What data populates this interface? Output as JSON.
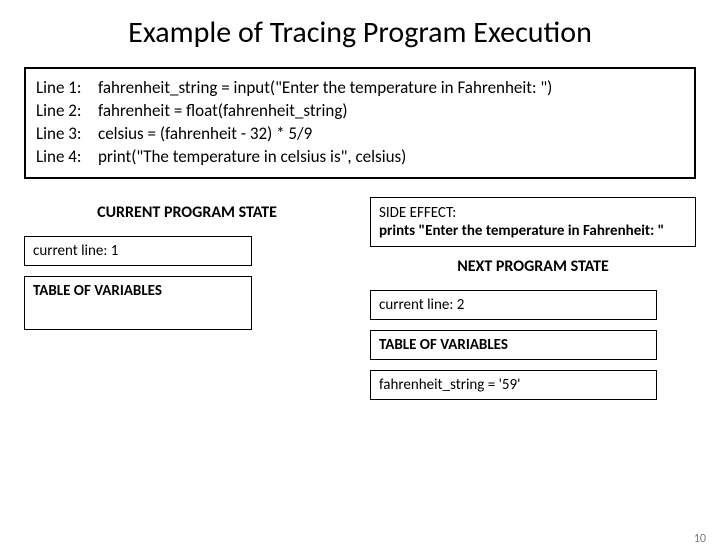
{
  "title": "Example of Tracing Program Execution",
  "code": {
    "lines": [
      {
        "label": "Line 1:",
        "text": "fahrenheit_string = input(\"Enter the temperature in Fahrenheit: \")"
      },
      {
        "label": "Line 2:",
        "text": "fahrenheit = float(fahrenheit_string)"
      },
      {
        "label": "Line 3:",
        "text": "celsius = (fahrenheit - 32) * 5/9"
      },
      {
        "label": "Line 4:",
        "text": "print(\"The temperature in celsius is\", celsius)"
      }
    ]
  },
  "current_state": {
    "heading": "CURRENT PROGRAM STATE",
    "current_line": "current line: 1",
    "table_heading": "TABLE OF VARIABLES"
  },
  "side_effect": {
    "label": "SIDE EFFECT:",
    "text": "prints \"Enter the temperature in Fahrenheit: \""
  },
  "next_state": {
    "heading": "NEXT PROGRAM STATE",
    "current_line": "current line: 2",
    "table_heading": "TABLE OF VARIABLES",
    "var1": "fahrenheit_string = '59'"
  },
  "page_number": "10"
}
